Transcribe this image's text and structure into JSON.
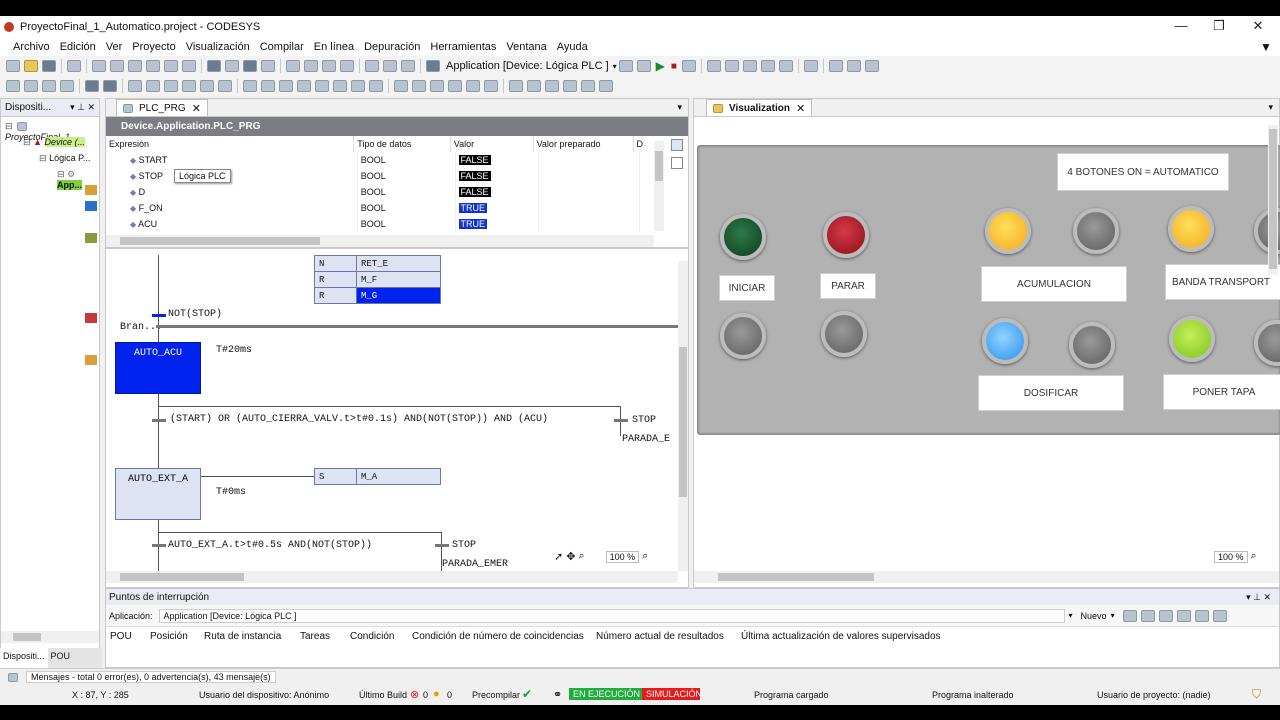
{
  "window": {
    "title": "ProyectoFinal_1_Automatico.project - CODESYS"
  },
  "menu": [
    "Archivo",
    "Edición",
    "Ver",
    "Proyecto",
    "Visualización",
    "Compilar",
    "En línea",
    "Depuración",
    "Herramientas",
    "Ventana",
    "Ayuda"
  ],
  "toolbar": {
    "application_selector": "Application [Device: Lógica PLC ]"
  },
  "devices": {
    "header": "Dispositi...",
    "tree": [
      "ProyectoFinal_1...",
      "Device (...",
      "Lógica P...",
      "App..."
    ],
    "bottom_tabs": [
      "Dispositi...",
      "POU"
    ]
  },
  "editor": {
    "tab": "PLC_PRG",
    "watch": {
      "path": "Device.Application.PLC_PRG",
      "columns": [
        "Expresión",
        "Tipo de datos",
        "Valor",
        "Valor preparado",
        "D"
      ],
      "rows": [
        {
          "expr": "START",
          "type": "BOOL",
          "value": "FALSE"
        },
        {
          "expr": "STOP",
          "type": "BOOL",
          "value": "FALSE"
        },
        {
          "expr": "D",
          "type": "BOOL",
          "value": "FALSE"
        },
        {
          "expr": "F_ON",
          "type": "BOOL",
          "value": "TRUE"
        },
        {
          "expr": "ACU",
          "type": "BOOL",
          "value": "TRUE"
        }
      ],
      "tooltip": "Lógica PLC"
    },
    "sfc": {
      "actions_top": [
        {
          "q": "N",
          "name": "RET_E"
        },
        {
          "q": "R",
          "name": "M_F"
        },
        {
          "q": "R",
          "name": "M_G"
        }
      ],
      "transition1": "NOT(STOP)",
      "branch_label": "Bran...",
      "step1": "AUTO_ACU",
      "step1_time": "T#20ms",
      "transition2": "(START) OR (AUTO_CIERRA_VALV.t>t#0.1s) AND(NOT(STOP)) AND (ACU)",
      "jump1": "STOP",
      "jump2": "PARADA_E",
      "step2": "AUTO_EXT_A",
      "step2_time": "T#0ms",
      "step2_action": {
        "q": "S",
        "name": "M_A"
      },
      "transition3": "AUTO_EXT_A.t>t#0.5s AND(NOT(STOP))",
      "jump3": "STOP",
      "jump4": "PARADA_EMER",
      "zoom": "100 %"
    }
  },
  "visualization": {
    "tab": "Visualization",
    "header_label": "4 BOTONES ON = AUTOMATICO",
    "buttons": [
      "INICIAR",
      "PARAR"
    ],
    "lamps": [
      "ACUMULACION",
      "BANDA TRANSPORT",
      "DOSIFICAR",
      "PONER TAPA"
    ],
    "zoom": "100 %"
  },
  "breakpoints": {
    "title": "Puntos de interrupción",
    "app_label": "Aplicación:",
    "app_value": "Application [Device: Lógica PLC ]",
    "new_label": "Nuevo",
    "columns": [
      "POU",
      "Posición",
      "Ruta de instancia",
      "Tareas",
      "Condición",
      "Condición de número de coincidencias",
      "Número actual de resultados",
      "Última actualización de valores supervisados"
    ]
  },
  "messages": "Mensajes - total 0 error(es), 0 advertencia(s), 43 mensaje(s)",
  "statusbar": {
    "coords": "X : 87, Y : 285",
    "user": "Usuario del dispositivo: Anónimo",
    "last_build": "Último Build",
    "errors": "0",
    "warnings": "0",
    "precompile": "Precompilar",
    "running": "EN EJECUCIÓN",
    "simulation": "SIMULACIÓN",
    "program_loaded": "Programa cargado",
    "program_unchanged": "Programa inalterado",
    "project_user": "Usuario de proyecto: (nadie)"
  },
  "colors": {
    "running_bg": "#1fae3c",
    "simulation_bg": "#e81b1b",
    "step_active": "#0022ee",
    "lamp_green": "#0b3d1e",
    "lamp_red": "#8a0d16",
    "lamp_yellow": "#f2c01f",
    "lamp_blue": "#2e8ef0",
    "lamp_lime": "#7fc31c",
    "lamp_off": "#7d7d7d"
  }
}
